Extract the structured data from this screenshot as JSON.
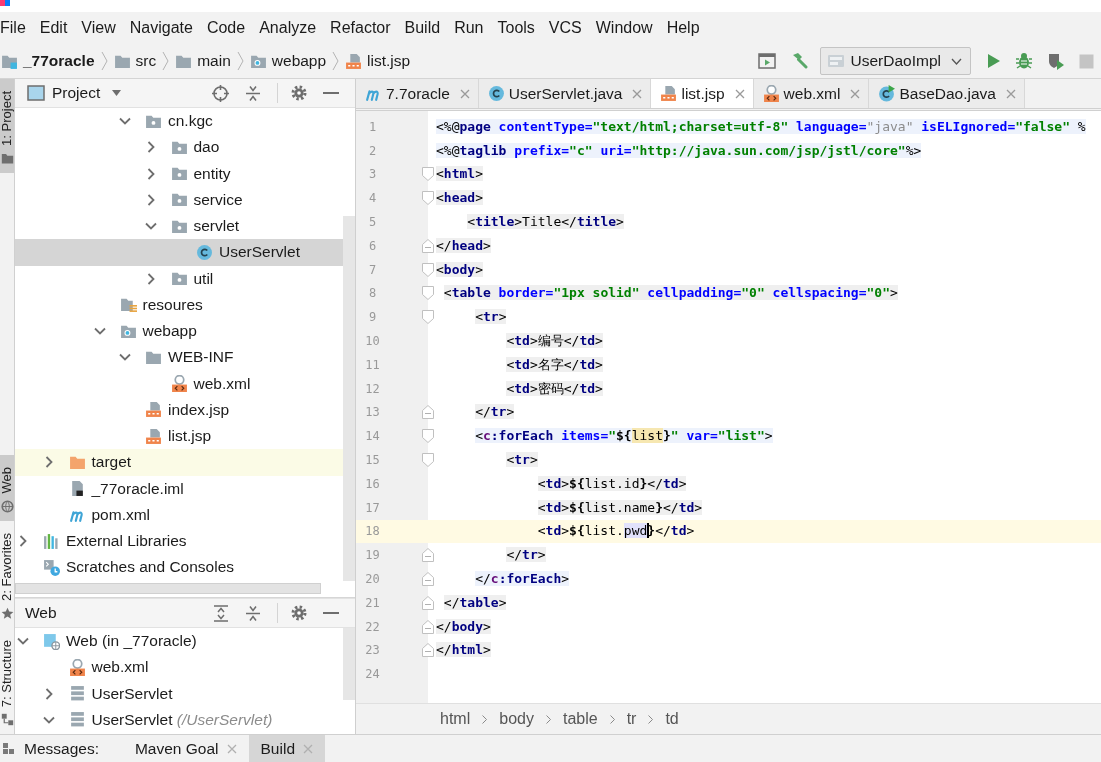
{
  "menu": [
    "File",
    "Edit",
    "View",
    "Navigate",
    "Code",
    "Analyze",
    "Refactor",
    "Build",
    "Run",
    "Tools",
    "VCS",
    "Window",
    "Help"
  ],
  "navigation": {
    "breadcrumbs": [
      {
        "label": "_77oracle",
        "kind": "module"
      },
      {
        "label": "src",
        "kind": "folder"
      },
      {
        "label": "main",
        "kind": "folder"
      },
      {
        "label": "webapp",
        "kind": "webroot"
      },
      {
        "label": "list.jsp",
        "kind": "jsp"
      }
    ],
    "run_config": "UserDaoImpl"
  },
  "tool_strip": {
    "top": [
      {
        "label": "1: Project",
        "kind": "project",
        "selected": true
      }
    ],
    "bottom": [
      {
        "label": "Web",
        "kind": "web",
        "selected": true
      },
      {
        "label": "2: Favorites",
        "kind": "favorites",
        "selected": false
      },
      {
        "label": "7: Structure",
        "kind": "structure",
        "selected": false
      }
    ]
  },
  "project_panel": {
    "title": "Project",
    "tree": [
      {
        "children": [
          {
            "children": [
              {
                "children": [
                  {
                    "children": [
                      {
                        "label": "cn.kgc",
                        "kind": "package",
                        "expanded": true,
                        "selected": false,
                        "highlighted": false,
                        "children": [
                          {
                            "label": "dao",
                            "kind": "package",
                            "expanded": false,
                            "selected": false,
                            "highlighted": false
                          },
                          {
                            "label": "entity",
                            "kind": "package",
                            "expanded": false,
                            "selected": false,
                            "highlighted": false
                          },
                          {
                            "label": "service",
                            "kind": "package",
                            "expanded": false,
                            "selected": false,
                            "highlighted": false
                          },
                          {
                            "label": "servlet",
                            "kind": "package",
                            "expanded": true,
                            "selected": false,
                            "highlighted": false,
                            "children": [
                              {
                                "label": "UserServlet",
                                "kind": "class",
                                "selected": true,
                                "highlighted": false
                              }
                            ]
                          },
                          {
                            "label": "util",
                            "kind": "package",
                            "expanded": false,
                            "selected": false,
                            "highlighted": false
                          }
                        ]
                      }
                    ]
                  },
                  {
                    "label": "resoures",
                    "kind": "resources",
                    "selected": false,
                    "highlighted": false
                  },
                  {
                    "label": "webapp",
                    "kind": "webroot",
                    "expanded": true,
                    "selected": false,
                    "highlighted": false,
                    "children": [
                      {
                        "label": "WEB-INF",
                        "kind": "folder",
                        "expanded": true,
                        "selected": false,
                        "highlighted": false,
                        "children": [
                          {
                            "label": "web.xml",
                            "kind": "xml",
                            "selected": false,
                            "highlighted": false
                          }
                        ]
                      },
                      {
                        "label": "index.jsp",
                        "kind": "jsp",
                        "selected": false,
                        "highlighted": false
                      },
                      {
                        "label": "list.jsp",
                        "kind": "jsp",
                        "selected": false,
                        "highlighted": false
                      }
                    ]
                  }
                ]
              }
            ]
          },
          {
            "label": "target",
            "kind": "excluded",
            "expanded": false,
            "selected": false,
            "highlighted": true
          },
          {
            "label": "_77oracle.iml",
            "kind": "iml",
            "selected": false,
            "highlighted": false
          },
          {
            "label": "pom.xml",
            "kind": "maven",
            "selected": false,
            "highlighted": false
          }
        ]
      },
      {
        "label": "External Libraries",
        "kind": "libraries",
        "expanded": false,
        "selected": false,
        "highlighted": false
      },
      {
        "label": "Scratches and Consoles",
        "kind": "scratches",
        "selected": false,
        "highlighted": false
      }
    ]
  },
  "web_panel": {
    "title": "Web",
    "tree": [
      {
        "label": "Web (in _77oracle)",
        "kind": "web-facet",
        "expanded": true,
        "selected": false,
        "children": [
          {
            "label": "web.xml",
            "kind": "xml",
            "selected": false
          },
          {
            "label": "UserServlet",
            "kind": "servlet",
            "expanded": false,
            "selected": false
          },
          {
            "label": "UserServlet",
            "hint": "(/UserServlet)",
            "kind": "servlet",
            "expanded": true,
            "selected": false
          }
        ]
      }
    ]
  },
  "editor": {
    "tabs": [
      {
        "label": "7.7oracle",
        "kind": "maven",
        "selected": false
      },
      {
        "label": "UserServlet.java",
        "kind": "class",
        "selected": false
      },
      {
        "label": "list.jsp",
        "kind": "jsp",
        "selected": true
      },
      {
        "label": "web.xml",
        "kind": "xml",
        "selected": false
      },
      {
        "label": "BaseDao.java",
        "kind": "class-run",
        "selected": false
      }
    ],
    "lines": [
      {
        "number": "1",
        "kind": "directive",
        "fold_start": false,
        "fold_end": false,
        "current": false,
        "tokens": [
          {
            "text": "<%@",
            "kind": "punct"
          },
          {
            "text": "page",
            "kind": "tag"
          },
          {
            "text": " contentType=",
            "kind": "attr"
          },
          {
            "text": "\"text/html;charset=utf-8\"",
            "kind": "value"
          },
          {
            "text": " language=",
            "kind": "attr"
          },
          {
            "text": "\"java\"",
            "kind": "dim"
          },
          {
            "text": " isELIgnored=",
            "kind": "attr"
          },
          {
            "text": "\"false\"",
            "kind": "value"
          },
          {
            "text": " %",
            "kind": "punct"
          }
        ]
      },
      {
        "number": "2",
        "kind": "directive",
        "fold_start": false,
        "fold_end": false,
        "current": false,
        "tokens": [
          {
            "text": "<%@",
            "kind": "punct"
          },
          {
            "text": "taglib",
            "kind": "tag"
          },
          {
            "text": " prefix=",
            "kind": "attr"
          },
          {
            "text": "\"c\"",
            "kind": "value"
          },
          {
            "text": " uri=",
            "kind": "attr"
          },
          {
            "text": "\"http://java.sun.com/jsp/jstl/core\"",
            "kind": "value"
          },
          {
            "text": "%>",
            "kind": "punct"
          }
        ]
      },
      {
        "number": "3",
        "kind": "tag",
        "fold_start": true,
        "fold_end": false,
        "current": false,
        "tokens": [
          {
            "text": "<",
            "kind": "punct"
          },
          {
            "text": "html",
            "kind": "tag"
          },
          {
            "text": ">",
            "kind": "punct"
          }
        ]
      },
      {
        "number": "4",
        "kind": "tag",
        "fold_start": true,
        "fold_end": false,
        "current": false,
        "tokens": [
          {
            "text": "<",
            "kind": "punct"
          },
          {
            "text": "head",
            "kind": "tag"
          },
          {
            "text": ">",
            "kind": "punct"
          }
        ]
      },
      {
        "number": "5",
        "kind": "tag",
        "fold_start": false,
        "fold_end": false,
        "current": false,
        "tokens": [
          {
            "text": "    <",
            "kind": "punct"
          },
          {
            "text": "title",
            "kind": "tag"
          },
          {
            "text": ">",
            "kind": "punct"
          },
          {
            "text": "Title",
            "kind": "text"
          },
          {
            "text": "</",
            "kind": "punct"
          },
          {
            "text": "title",
            "kind": "tag"
          },
          {
            "text": ">",
            "kind": "punct"
          }
        ]
      },
      {
        "number": "6",
        "kind": "tag",
        "fold_start": false,
        "fold_end": true,
        "current": false,
        "tokens": [
          {
            "text": "</",
            "kind": "punct"
          },
          {
            "text": "head",
            "kind": "tag"
          },
          {
            "text": ">",
            "kind": "punct"
          }
        ]
      },
      {
        "number": "7",
        "kind": "tag",
        "fold_start": true,
        "fold_end": false,
        "current": false,
        "tokens": [
          {
            "text": "<",
            "kind": "punct"
          },
          {
            "text": "body",
            "kind": "tag"
          },
          {
            "text": ">",
            "kind": "punct"
          }
        ]
      },
      {
        "number": "8",
        "kind": "tag",
        "fold_start": true,
        "fold_end": false,
        "current": false,
        "tokens": [
          {
            "text": " <",
            "kind": "punct"
          },
          {
            "text": "table",
            "kind": "tag"
          },
          {
            "text": " border=",
            "kind": "attr"
          },
          {
            "text": "\"1px solid\"",
            "kind": "value"
          },
          {
            "text": " cellpadding=",
            "kind": "attr"
          },
          {
            "text": "\"0\"",
            "kind": "value"
          },
          {
            "text": " cellspacing=",
            "kind": "attr"
          },
          {
            "text": "\"0\"",
            "kind": "value"
          },
          {
            "text": ">",
            "kind": "punct"
          }
        ]
      },
      {
        "number": "9",
        "kind": "tag",
        "fold_start": true,
        "fold_end": false,
        "current": false,
        "tokens": [
          {
            "text": "     <",
            "kind": "punct"
          },
          {
            "text": "tr",
            "kind": "tag"
          },
          {
            "text": ">",
            "kind": "punct"
          }
        ]
      },
      {
        "number": "10",
        "kind": "tag",
        "fold_start": false,
        "fold_end": false,
        "current": false,
        "tokens": [
          {
            "text": "         <",
            "kind": "punct"
          },
          {
            "text": "td",
            "kind": "tag"
          },
          {
            "text": ">",
            "kind": "punct"
          },
          {
            "text": "编号",
            "kind": "text"
          },
          {
            "text": "</",
            "kind": "punct"
          },
          {
            "text": "td",
            "kind": "tag"
          },
          {
            "text": ">",
            "kind": "punct"
          }
        ]
      },
      {
        "number": "11",
        "kind": "tag",
        "fold_start": false,
        "fold_end": false,
        "current": false,
        "tokens": [
          {
            "text": "         <",
            "kind": "punct"
          },
          {
            "text": "td",
            "kind": "tag"
          },
          {
            "text": ">",
            "kind": "punct"
          },
          {
            "text": "名字",
            "kind": "text"
          },
          {
            "text": "</",
            "kind": "punct"
          },
          {
            "text": "td",
            "kind": "tag"
          },
          {
            "text": ">",
            "kind": "punct"
          }
        ]
      },
      {
        "number": "12",
        "kind": "tag",
        "fold_start": false,
        "fold_end": false,
        "current": false,
        "tokens": [
          {
            "text": "         <",
            "kind": "punct"
          },
          {
            "text": "td",
            "kind": "tag"
          },
          {
            "text": ">",
            "kind": "punct"
          },
          {
            "text": "密码",
            "kind": "text"
          },
          {
            "text": "</",
            "kind": "punct"
          },
          {
            "text": "td",
            "kind": "tag"
          },
          {
            "text": ">",
            "kind": "punct"
          }
        ]
      },
      {
        "number": "13",
        "kind": "tag",
        "fold_start": false,
        "fold_end": true,
        "current": false,
        "tokens": [
          {
            "text": "     </",
            "kind": "punct"
          },
          {
            "text": "tr",
            "kind": "tag"
          },
          {
            "text": ">",
            "kind": "punct"
          }
        ]
      },
      {
        "number": "14",
        "kind": "directive",
        "fold_start": true,
        "fold_end": false,
        "current": false,
        "tokens": [
          {
            "text": "     <",
            "kind": "punct"
          },
          {
            "text": "c",
            "kind": "ns"
          },
          {
            "text": ":forEach",
            "kind": "tag"
          },
          {
            "text": " items=",
            "kind": "attr"
          },
          {
            "text": "\"",
            "kind": "value"
          },
          {
            "text": "${",
            "kind": "el"
          },
          {
            "text": "list",
            "kind": "usage"
          },
          {
            "text": "}",
            "kind": "el"
          },
          {
            "text": "\"",
            "kind": "value"
          },
          {
            "text": " var=",
            "kind": "attr"
          },
          {
            "text": "\"list\"",
            "kind": "value"
          },
          {
            "text": ">",
            "kind": "punct"
          }
        ]
      },
      {
        "number": "15",
        "kind": "tag",
        "fold_start": true,
        "fold_end": false,
        "current": false,
        "tokens": [
          {
            "text": "         <",
            "kind": "punct"
          },
          {
            "text": "tr",
            "kind": "tag"
          },
          {
            "text": ">",
            "kind": "punct"
          }
        ]
      },
      {
        "number": "16",
        "kind": "tag",
        "fold_start": false,
        "fold_end": false,
        "current": false,
        "tokens": [
          {
            "text": "             <",
            "kind": "punct"
          },
          {
            "text": "td",
            "kind": "tag"
          },
          {
            "text": ">",
            "kind": "punct"
          },
          {
            "text": "${",
            "kind": "el"
          },
          {
            "text": "list.id",
            "kind": "text"
          },
          {
            "text": "}",
            "kind": "el"
          },
          {
            "text": "</",
            "kind": "punct"
          },
          {
            "text": "td",
            "kind": "tag"
          },
          {
            "text": ">",
            "kind": "punct"
          }
        ]
      },
      {
        "number": "17",
        "kind": "tag",
        "fold_start": false,
        "fold_end": false,
        "current": false,
        "tokens": [
          {
            "text": "             <",
            "kind": "punct"
          },
          {
            "text": "td",
            "kind": "tag"
          },
          {
            "text": ">",
            "kind": "punct"
          },
          {
            "text": "${",
            "kind": "el"
          },
          {
            "text": "list.name",
            "kind": "text"
          },
          {
            "text": "}",
            "kind": "el"
          },
          {
            "text": "</",
            "kind": "punct"
          },
          {
            "text": "td",
            "kind": "tag"
          },
          {
            "text": ">",
            "kind": "punct"
          }
        ]
      },
      {
        "number": "18",
        "kind": "plain",
        "fold_start": false,
        "fold_end": false,
        "current": true,
        "tokens": [
          {
            "text": "             <",
            "kind": "punct"
          },
          {
            "text": "td",
            "kind": "tag"
          },
          {
            "text": ">",
            "kind": "punct"
          },
          {
            "text": "${",
            "kind": "el"
          },
          {
            "text": "list.",
            "kind": "text"
          },
          {
            "text": "pwd",
            "kind": "caret-word"
          },
          {
            "text": "}",
            "kind": "el"
          },
          {
            "text": "</",
            "kind": "punct"
          },
          {
            "text": "td",
            "kind": "tag"
          },
          {
            "text": ">",
            "kind": "punct"
          }
        ]
      },
      {
        "number": "19",
        "kind": "tag",
        "fold_start": false,
        "fold_end": true,
        "current": false,
        "tokens": [
          {
            "text": "         </",
            "kind": "punct"
          },
          {
            "text": "tr",
            "kind": "tag"
          },
          {
            "text": ">",
            "kind": "punct"
          }
        ]
      },
      {
        "number": "20",
        "kind": "directive",
        "fold_start": false,
        "fold_end": true,
        "current": false,
        "tokens": [
          {
            "text": "     </",
            "kind": "punct"
          },
          {
            "text": "c",
            "kind": "ns"
          },
          {
            "text": ":forEach",
            "kind": "tag"
          },
          {
            "text": ">",
            "kind": "punct"
          }
        ]
      },
      {
        "number": "21",
        "kind": "tag",
        "fold_start": false,
        "fold_end": true,
        "current": false,
        "tokens": [
          {
            "text": " </",
            "kind": "punct"
          },
          {
            "text": "table",
            "kind": "tag"
          },
          {
            "text": ">",
            "kind": "punct"
          }
        ]
      },
      {
        "number": "22",
        "kind": "tag",
        "fold_start": false,
        "fold_end": true,
        "current": false,
        "tokens": [
          {
            "text": "</",
            "kind": "punct"
          },
          {
            "text": "body",
            "kind": "tag"
          },
          {
            "text": ">",
            "kind": "punct"
          }
        ]
      },
      {
        "number": "23",
        "kind": "tag",
        "fold_start": false,
        "fold_end": true,
        "current": false,
        "tokens": [
          {
            "text": "</",
            "kind": "punct"
          },
          {
            "text": "html",
            "kind": "tag"
          },
          {
            "text": ">",
            "kind": "punct"
          }
        ]
      },
      {
        "number": "24",
        "fold_start": false,
        "fold_end": false,
        "current": false
      }
    ],
    "breadcrumbs": [
      "html",
      "body",
      "table",
      "tr",
      "td"
    ]
  },
  "bottom_bar": {
    "label": "Messages:",
    "tabs": [
      {
        "label": "Maven Goal",
        "selected": false
      },
      {
        "label": "Build",
        "selected": true
      }
    ]
  }
}
